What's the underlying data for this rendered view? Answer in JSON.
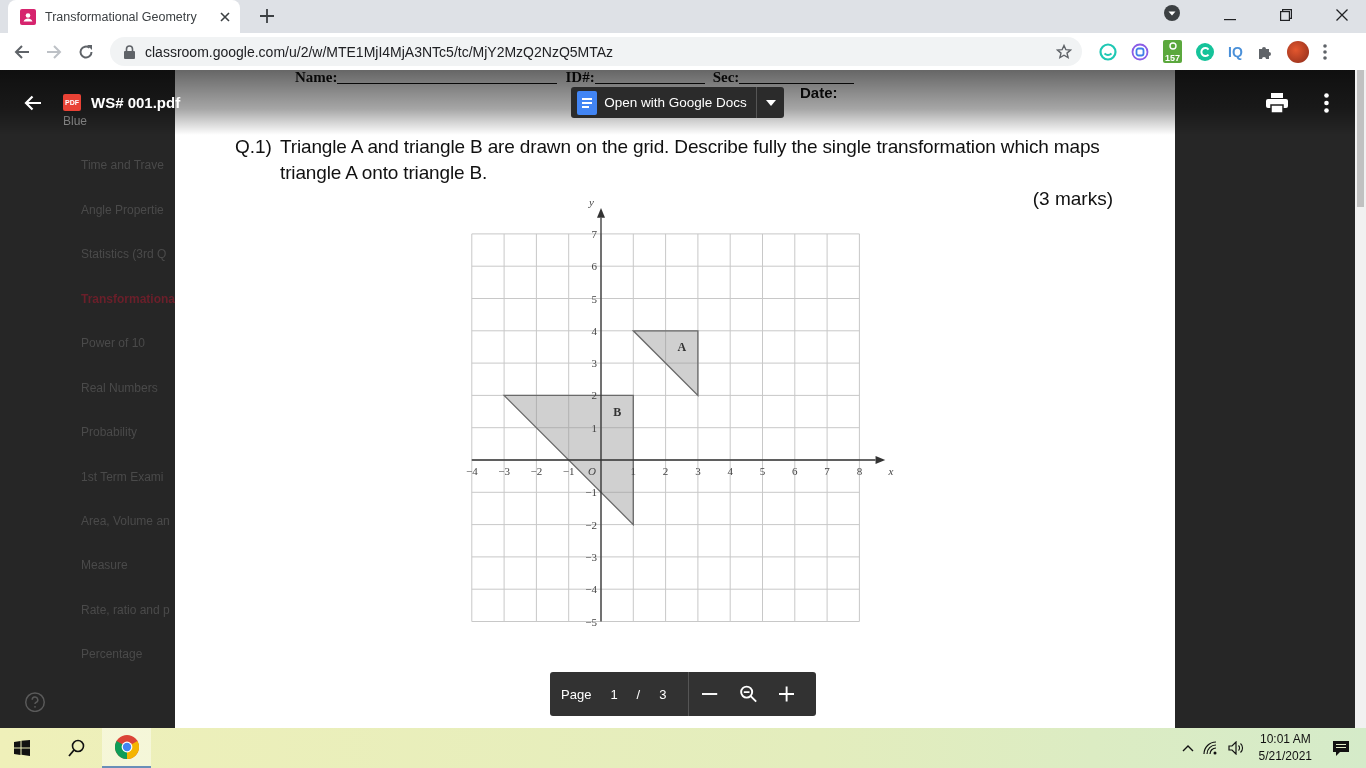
{
  "browser": {
    "tab": {
      "title": "Transformational Geometry",
      "selected": true
    },
    "url": "classroom.google.com/u/2/w/MTE1MjI4MjA3NTc5/tc/MjY2MzQ2NzQ5MTAz",
    "forward_disabled": true,
    "extensions": [
      {
        "kind": "ring"
      },
      {
        "kind": "circle"
      },
      {
        "kind": "counter",
        "badge": "157"
      },
      {
        "kind": "g"
      },
      {
        "kind": "text",
        "text": "IQ"
      },
      {
        "kind": "puzzle"
      },
      {
        "kind": "avatar"
      }
    ]
  },
  "sidebar": {
    "caption": "Blue",
    "items": [
      {
        "label": "Time and Trave",
        "selected": false
      },
      {
        "label": "Angle Propertie",
        "selected": false
      },
      {
        "label": "Statistics (3rd Q",
        "selected": false
      },
      {
        "label": "Transformationa",
        "selected": true
      },
      {
        "label": "Power of 10",
        "selected": false
      },
      {
        "label": "Real Numbers",
        "selected": false
      },
      {
        "label": "Probability",
        "selected": false
      },
      {
        "label": "1st Term Exami",
        "selected": false
      },
      {
        "label": "Area, Volume an",
        "selected": false
      },
      {
        "label": "Measure",
        "selected": false
      },
      {
        "label": "Rate, ratio and p",
        "selected": false
      },
      {
        "label": "Percentage",
        "selected": false
      }
    ]
  },
  "viewer": {
    "file_badge": "PDF",
    "file_name": "WS# 001.pdf",
    "open_button": "Open with Google Docs"
  },
  "page": {
    "header_fields": [
      {
        "label": "Name:"
      },
      {
        "label": "ID#:"
      },
      {
        "label": "Sec:"
      }
    ],
    "date_label": "Date:",
    "question": {
      "number": "Q.1)",
      "text": "Triangle A and triangle B are drawn on the grid. Describe fully the single transformation which maps triangle A onto triangle B.",
      "marks": "(3 marks)"
    },
    "grid": {
      "x_ticks": [
        "−4",
        "−3",
        "−2",
        "−1",
        "1",
        "2",
        "3",
        "4",
        "5",
        "6",
        "7",
        "8"
      ],
      "y_ticks": [
        "7",
        "6",
        "5",
        "4",
        "3",
        "2",
        "1",
        "−1",
        "−2",
        "−3",
        "−4",
        "−5"
      ],
      "x_label": "x",
      "y_label": "y",
      "origin_label": "O",
      "triangles": [
        {
          "label": "A"
        },
        {
          "label": "B"
        }
      ]
    }
  },
  "page_toolbar": {
    "page_label": "Page",
    "current": "1",
    "separator": "/",
    "total": "3"
  },
  "taskbar": {
    "time": "10:01 AM",
    "date": "5/21/2021"
  }
}
